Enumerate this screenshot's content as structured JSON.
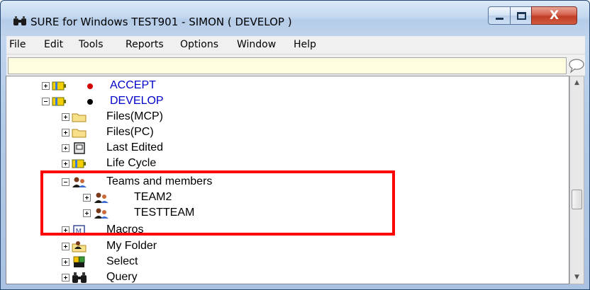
{
  "window": {
    "title": "SURE for Windows TEST901 - SIMON ( DEVELOP )",
    "close_glyph": "X"
  },
  "menu": {
    "items": [
      "File",
      "Edit",
      "Tools",
      "Reports",
      "Options",
      "Window",
      "Help"
    ]
  },
  "command_input": {
    "value": ""
  },
  "tree": {
    "rows": [
      {
        "label": "ACCEPT",
        "icon": "battery-icon",
        "state": "collapsed",
        "dot_color": "#d40000"
      },
      {
        "label": "DEVELOP",
        "icon": "battery-icon",
        "state": "expanded",
        "dot_color": "#000000"
      },
      {
        "label": "Files(MCP)",
        "icon": "folder-icon",
        "state": "collapsed"
      },
      {
        "label": "Files(PC)",
        "icon": "folder-icon",
        "state": "collapsed"
      },
      {
        "label": "Last Edited",
        "icon": "recent-document-icon",
        "state": "collapsed"
      },
      {
        "label": "Life Cycle",
        "icon": "battery-icon",
        "state": "collapsed"
      },
      {
        "label": "Teams and members",
        "icon": "team-icon",
        "state": "expanded"
      },
      {
        "label": "TEAM2",
        "icon": "team-icon",
        "state": "collapsed"
      },
      {
        "label": "TESTTEAM",
        "icon": "team-icon",
        "state": "collapsed"
      },
      {
        "label": "Macros",
        "icon": "macro-icon",
        "state": "collapsed"
      },
      {
        "label": "My Folder",
        "icon": "my-folder-icon",
        "state": "collapsed"
      },
      {
        "label": "Select",
        "icon": "select-icon",
        "state": "collapsed"
      },
      {
        "label": "Query",
        "icon": "binoculars-icon",
        "state": "collapsed"
      }
    ]
  },
  "colors": {
    "highlight": "#ff0000",
    "link_blue": "#0000c8",
    "command_bg": "#fffde0"
  }
}
